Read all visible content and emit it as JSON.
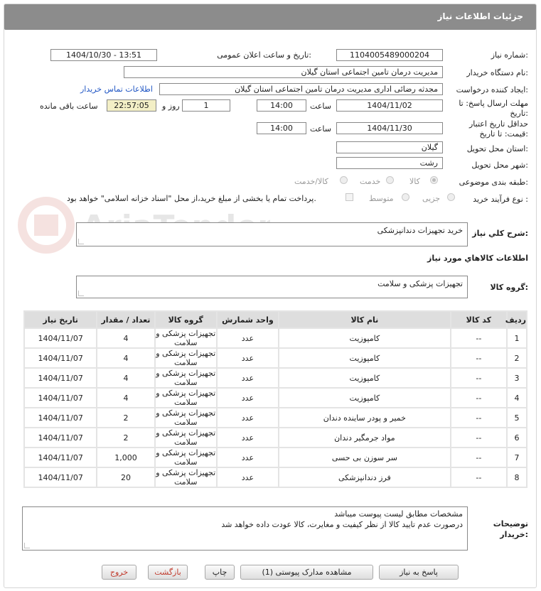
{
  "header": {
    "title": "جزئیات اطلاعات نیاز"
  },
  "form": {
    "need_number_label": "شماره نیاز:",
    "need_number": "1104005489000204",
    "announce_label": "تاریخ و ساعت اعلان عمومی:",
    "announce_value": "1404/10/30 - 13:51",
    "buyer_org_label": "نام دستگاه خریدار:",
    "buyer_org": "مدیریت درمان تامین اجتماعی استان گیلان",
    "creator_label": "ایجاد کننده درخواست:",
    "creator": "مجدثه رضائی اداری مدیریت درمان تامین اجتماعی استان گیلان",
    "contact_link": "اطلاعات تماس خریدار",
    "deadline_label_1": "مهلت ارسال پاسخ: تا",
    "deadline_label_2": "تاریخ:",
    "deadline_date": "1404/11/02",
    "time_label": "ساعت",
    "deadline_time": "14:00",
    "days_value": "1",
    "days_label": "روز و",
    "remaining_time": "22:57:05",
    "remaining_label": "ساعت باقی مانده",
    "validity_label_1": "حداقل تاریخ اعتبار",
    "validity_label_2": "قیمت: تا تاریخ:",
    "validity_date": "1404/11/30",
    "validity_time": "14:00",
    "province_label": "استان محل تحویل:",
    "province": "گیلان",
    "city_label": "شهر محل تحویل:",
    "city": "رشت",
    "category_label": "طبقه بندی موضوعی:",
    "category_options": [
      "کالا",
      "خدمت",
      "کالا/خدمت"
    ],
    "process_label": "نوع فرآیند خرید :",
    "process_options": [
      "جزیی",
      "متوسط"
    ],
    "payment_note": "پرداخت تمام یا بخشی از مبلغ خرید،از محل \"اسناد خزانه اسلامی\" خواهد بود.",
    "summary_label": "شرح کلي نیاز:",
    "summary": "خرید تجهیزات دندانپزشکی",
    "goods_info_label": "اطلاعات کالاهاي مورد نیاز",
    "goods_group_label": "گروه کالا:",
    "goods_group": "تجهیزات پزشکی و سلامت"
  },
  "table": {
    "headers": [
      "ردیف",
      "کد کالا",
      "نام کالا",
      "واحد شمارش",
      "گروه کالا",
      "تعداد / مقدار",
      "تاریخ نیاز"
    ],
    "rows": [
      [
        "1",
        "--",
        "کامپوزیت",
        "عدد",
        "تجهیزات پزشکی و سلامت",
        "4",
        "1404/11/07"
      ],
      [
        "2",
        "--",
        "کامپوزیت",
        "عدد",
        "تجهیزات پزشکی و سلامت",
        "4",
        "1404/11/07"
      ],
      [
        "3",
        "--",
        "کامپوزیت",
        "عدد",
        "تجهیزات پزشکی و سلامت",
        "4",
        "1404/11/07"
      ],
      [
        "4",
        "--",
        "کامپوزیت",
        "عدد",
        "تجهیزات پزشکی و سلامت",
        "4",
        "1404/11/07"
      ],
      [
        "5",
        "--",
        "خمیر و پودر ساینده دندان",
        "عدد",
        "تجهیزات پزشکی و سلامت",
        "2",
        "1404/11/07"
      ],
      [
        "6",
        "--",
        "مواد جرمگیر دندان",
        "عدد",
        "تجهیزات پزشکی و سلامت",
        "2",
        "1404/11/07"
      ],
      [
        "7",
        "--",
        "سر سوزن بی حسی",
        "عدد",
        "تجهیزات پزشکی و سلامت",
        "1,000",
        "1404/11/07"
      ],
      [
        "8",
        "--",
        "فرز دندانپزشکی",
        "عدد",
        "تجهیزات پزشکی و سلامت",
        "20",
        "1404/11/07"
      ]
    ]
  },
  "notes": {
    "label_1": "توضیحات",
    "label_2": "خریدار:",
    "line1": "مشخصات مطابق لیست پیوست میباشد",
    "line2": "درصورت عدم تایید کالا از نظر کیفیت و مغایرت، کالا عودت داده خواهد شد"
  },
  "buttons": {
    "reply": "پاسخ به نیاز",
    "view_docs": "مشاهده مدارک پیوستی (1)",
    "print": "چاپ",
    "back": "بازگشت",
    "exit": "خروج"
  },
  "watermark": {
    "text": "AriaTender.net"
  },
  "colors": {
    "title_bar": "#8c8c8c",
    "link": "#1f55c4",
    "remaining_bg": "#f3efc6",
    "exit_text": "#c0392b"
  }
}
